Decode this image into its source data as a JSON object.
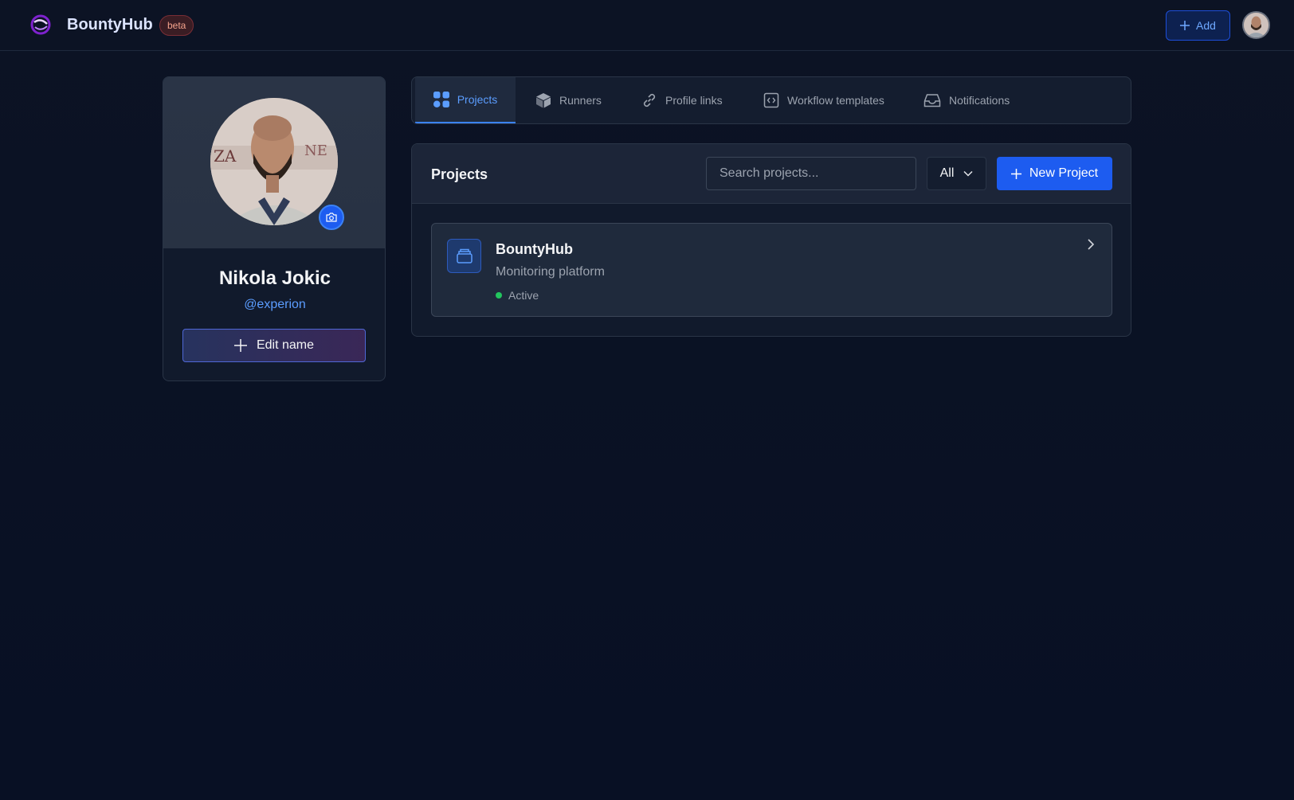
{
  "header": {
    "brand": "BountyHub",
    "badge": "beta",
    "add_label": "Add"
  },
  "profile": {
    "name": "Nikola Jokic",
    "handle": "@experion",
    "edit_label": "Edit name"
  },
  "tabs": [
    {
      "label": "Projects",
      "icon": "grid-icon",
      "active": true
    },
    {
      "label": "Runners",
      "icon": "cube-icon",
      "active": false
    },
    {
      "label": "Profile links",
      "icon": "link-icon",
      "active": false
    },
    {
      "label": "Workflow templates",
      "icon": "code-icon",
      "active": false
    },
    {
      "label": "Notifications",
      "icon": "inbox-icon",
      "active": false
    }
  ],
  "projects": {
    "title": "Projects",
    "search_placeholder": "Search projects...",
    "filter_value": "All",
    "new_label": "New Project",
    "items": [
      {
        "name": "BountyHub",
        "description": "Monitoring platform",
        "status": "Active"
      }
    ]
  },
  "colors": {
    "accent": "#1d5cf0",
    "link": "#5b9dff",
    "status_active": "#22c55e",
    "beta_text": "#f4a38c"
  }
}
